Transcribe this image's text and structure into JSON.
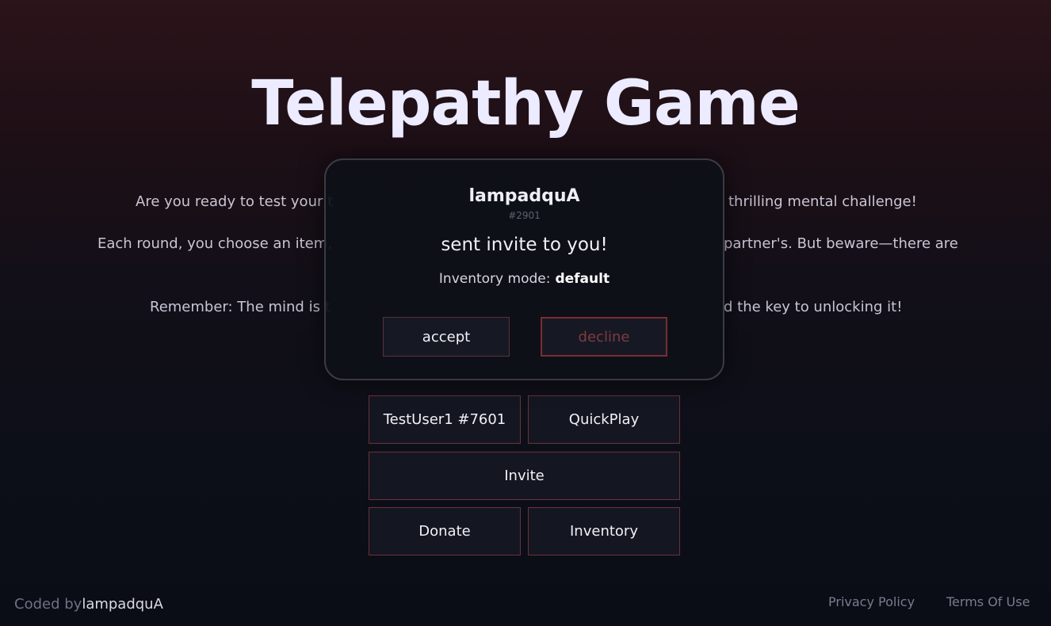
{
  "page": {
    "title": "Telepathy Game",
    "description": {
      "line1_left": "Are you ready to test your t",
      "line1_right": "thrilling mental challenge!",
      "line2_left": "Each round, you choose an item,",
      "line2_right": "partner's. But beware—there are",
      "line3_left": "Remember: The mind is t",
      "line3_right": "d the key to unlocking it!"
    }
  },
  "menu": {
    "user_label": "TestUser1 #7601",
    "quickplay_label": "QuickPlay",
    "invite_label": "Invite",
    "donate_label": "Donate",
    "inventory_label": "Inventory"
  },
  "invite_modal": {
    "username": "lampadquA",
    "tag": "#2901",
    "message": "sent invite to you!",
    "mode_label": "Inventory mode:",
    "mode_value": "default",
    "accept_label": "accept",
    "decline_label": "decline"
  },
  "footer": {
    "coded_by_label": "Coded by",
    "author": "lampadquA",
    "privacy_label": "Privacy Policy",
    "terms_label": "Terms Of Use"
  }
}
